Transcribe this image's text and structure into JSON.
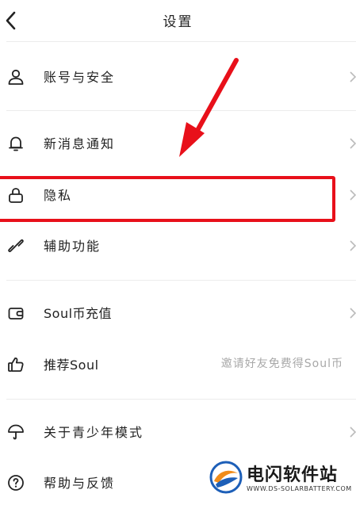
{
  "header": {
    "title": "设置"
  },
  "items": [
    {
      "label": "账号与安全",
      "icon": "user-icon"
    },
    {
      "label": "新消息通知",
      "icon": "bell-icon"
    },
    {
      "label": "隐私",
      "icon": "lock-icon"
    },
    {
      "label": "辅助功能",
      "icon": "link-icon"
    },
    {
      "label": "Soul币充值",
      "icon": "wallet-icon"
    },
    {
      "label": "推荐Soul",
      "icon": "thumbs-up-icon",
      "hint": "邀请好友免费得Soul币"
    },
    {
      "label": "关于青少年模式",
      "icon": "umbrella-icon"
    },
    {
      "label": "帮助与反馈",
      "icon": "help-icon"
    }
  ],
  "annotation": {
    "color": "#e8101a"
  },
  "watermark": {
    "name": "电闪软件站",
    "domain": "WWW.DS-SOLARBATTERY.COM"
  }
}
